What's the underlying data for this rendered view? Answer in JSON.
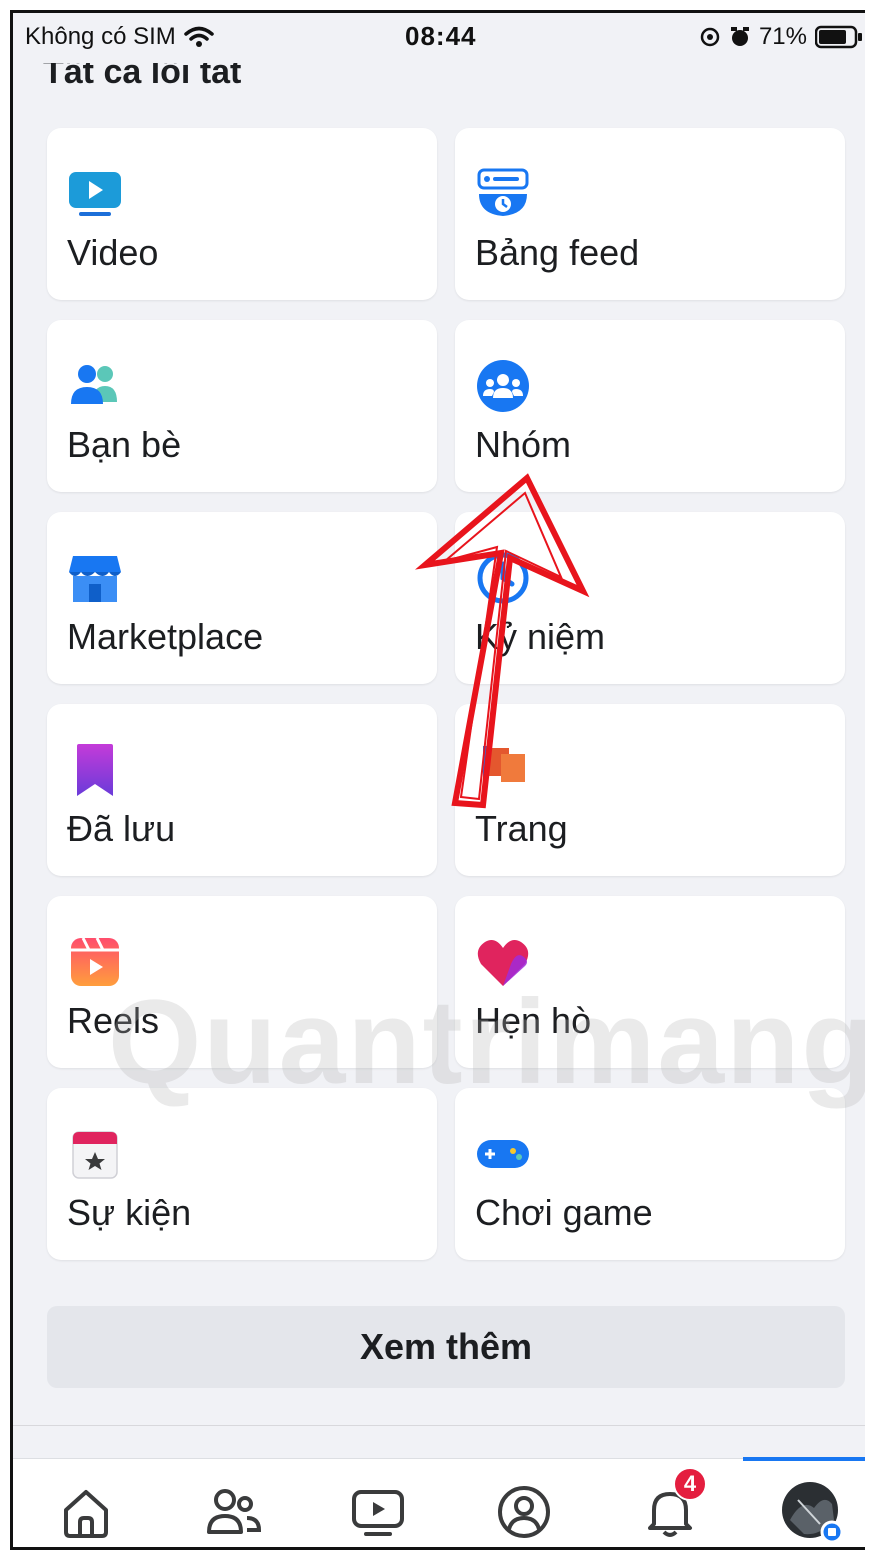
{
  "status_bar": {
    "carrier": "Không có SIM",
    "time": "08:44",
    "battery": "71%"
  },
  "section_title": "Tất cả lối tắt",
  "shortcuts": [
    {
      "label": "Video",
      "icon": "video-icon"
    },
    {
      "label": "Bảng feed",
      "icon": "feed-icon"
    },
    {
      "label": "Bạn bè",
      "icon": "friends-icon"
    },
    {
      "label": "Nhóm",
      "icon": "groups-icon"
    },
    {
      "label": "Marketplace",
      "icon": "marketplace-icon"
    },
    {
      "label": "Kỷ niệm",
      "icon": "memories-icon"
    },
    {
      "label": "Đã lưu",
      "icon": "saved-icon"
    },
    {
      "label": "Trang",
      "icon": "pages-icon"
    },
    {
      "label": "Reels",
      "icon": "reels-icon"
    },
    {
      "label": "Hẹn hò",
      "icon": "dating-icon"
    },
    {
      "label": "Sự kiện",
      "icon": "events-icon"
    },
    {
      "label": "Chơi game",
      "icon": "gaming-icon"
    }
  ],
  "see_more_label": "Xem thêm",
  "tabbar": {
    "notifications_badge": "4",
    "items": [
      "home-icon",
      "friends-tab-icon",
      "watch-icon",
      "profile-icon",
      "bell-icon",
      "menu-avatar"
    ]
  },
  "colors": {
    "accent": "#1877f2",
    "badge": "#e41e3f",
    "annotation_arrow": "#e8141c"
  }
}
